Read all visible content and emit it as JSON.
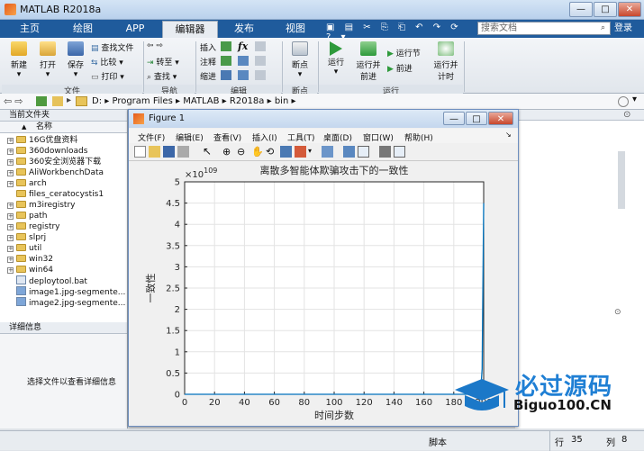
{
  "window": {
    "title": "MATLAB R2018a"
  },
  "tabs": [
    {
      "label": "主页"
    },
    {
      "label": "绘图"
    },
    {
      "label": "APP"
    },
    {
      "label": "编辑器"
    },
    {
      "label": "发布"
    },
    {
      "label": "视图"
    }
  ],
  "search": {
    "placeholder": "搜索文档"
  },
  "login_label": "登录",
  "ribbon": {
    "new": "新建",
    "open": "打开",
    "save": "保存",
    "find_files": "查找文件",
    "compare": "比较",
    "print": "打印",
    "goto": "转至",
    "find": "查找",
    "insert": "插入",
    "comment": "注释",
    "indent": "缩进",
    "fx": "fx",
    "breakpoints": "断点",
    "run": "运行",
    "run_advance": "运行并前进",
    "run_section": "运行节",
    "advance": "前进",
    "run_time": "运行并计时",
    "sections": {
      "file": "文件",
      "navigate": "导航",
      "edit": "编辑",
      "breakpoints": "断点",
      "run": "运行"
    }
  },
  "address": {
    "parts": [
      "D:",
      "Program Files",
      "MATLAB",
      "R2018a",
      "bin"
    ]
  },
  "left_pane": {
    "title": "当前文件夹",
    "name_header": "名称",
    "sort_arrow": "▲",
    "items": [
      {
        "name": "16G优盘资料",
        "type": "folder"
      },
      {
        "name": "360downloads",
        "type": "folder"
      },
      {
        "name": "360安全浏览器下载",
        "type": "folder"
      },
      {
        "name": "AliWorkbenchData",
        "type": "folder"
      },
      {
        "name": "arch",
        "type": "folder"
      },
      {
        "name": "files_ceratocystis1",
        "type": "folder"
      },
      {
        "name": "m3iregistry",
        "type": "folder"
      },
      {
        "name": "path",
        "type": "folder"
      },
      {
        "name": "registry",
        "type": "folder"
      },
      {
        "name": "slprj",
        "type": "folder"
      },
      {
        "name": "util",
        "type": "folder"
      },
      {
        "name": "win32",
        "type": "folder"
      },
      {
        "name": "win64",
        "type": "folder"
      },
      {
        "name": "deploytool.bat",
        "type": "file"
      },
      {
        "name": "image1.jpg-segmente...",
        "type": "file"
      },
      {
        "name": "image2.jpg-segmente...",
        "type": "file"
      }
    ],
    "details_title": "详细信息",
    "details_text": "选择文件以查看详细信息"
  },
  "status": {
    "script": "脚本",
    "line_label": "行",
    "line": "35",
    "col_label": "列",
    "col": "8"
  },
  "figure": {
    "title": "Figure 1",
    "menus": [
      "文件(F)",
      "编辑(E)",
      "查看(V)",
      "插入(I)",
      "工具(T)",
      "桌面(D)",
      "窗口(W)",
      "帮助(H)"
    ]
  },
  "chart_data": {
    "type": "line",
    "title": "离散多智能体欺骗攻击下的一致性",
    "xlabel": "时间步数",
    "ylabel": "一致性",
    "y_exponent": "×10",
    "y_exponent_power": "109",
    "xlim": [
      0,
      200
    ],
    "ylim": [
      0,
      5
    ],
    "xticks": [
      0,
      20,
      40,
      60,
      80,
      100,
      120,
      140,
      160,
      180,
      200
    ],
    "yticks": [
      0,
      0.5,
      1,
      1.5,
      2,
      2.5,
      3,
      3.5,
      4,
      4.5,
      5
    ],
    "grid": true,
    "series": [
      {
        "color": "#0072bd",
        "x": [
          0,
          20,
          40,
          60,
          80,
          100,
          120,
          140,
          160,
          180,
          190,
          195,
          197,
          198,
          199,
          200
        ],
        "y": [
          0,
          0,
          0,
          0,
          0,
          0,
          0,
          0,
          0,
          0,
          0.001,
          0.005,
          0.02,
          0.08,
          0.6,
          4.5
        ]
      }
    ]
  },
  "watermark": {
    "brand": "必过源码",
    "url": "Biguo100.CN"
  }
}
